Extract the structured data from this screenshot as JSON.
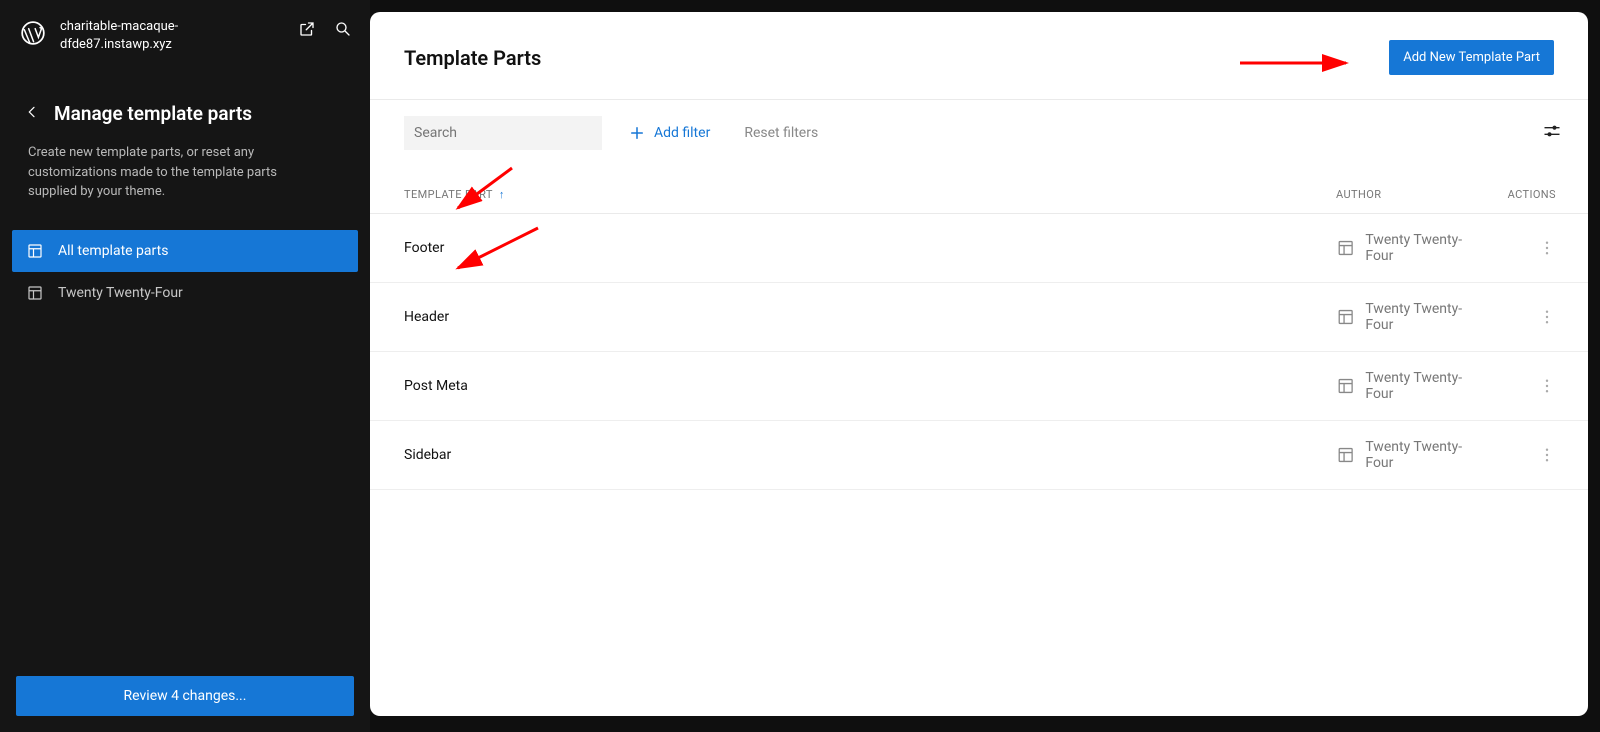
{
  "site": {
    "name": "charitable-macaque-dfde87.instawp.xyz"
  },
  "sidebar": {
    "title": "Manage template parts",
    "description": "Create new template parts, or reset any customizations made to the template parts supplied by your theme.",
    "items": [
      {
        "label": "All template parts",
        "active": true
      },
      {
        "label": "Twenty Twenty-Four",
        "active": false
      }
    ],
    "review_label": "Review 4 changes..."
  },
  "panel": {
    "title": "Template Parts",
    "add_button_label": "Add New Template Part",
    "search_placeholder": "Search",
    "add_filter_label": "Add filter",
    "reset_filters_label": "Reset filters",
    "columns": {
      "part": "TEMPLATE PART",
      "author": "AUTHOR",
      "actions": "ACTIONS"
    },
    "rows": [
      {
        "name": "Footer",
        "author": "Twenty Twenty-Four"
      },
      {
        "name": "Header",
        "author": "Twenty Twenty-Four"
      },
      {
        "name": "Post Meta",
        "author": "Twenty Twenty-Four"
      },
      {
        "name": "Sidebar",
        "author": "Twenty Twenty-Four"
      }
    ]
  }
}
